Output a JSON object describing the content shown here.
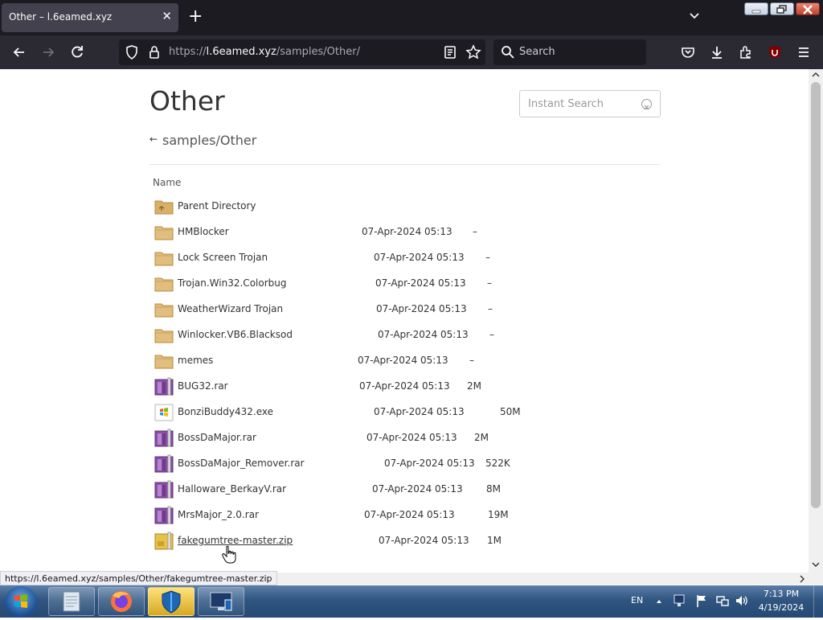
{
  "browser": {
    "tab": {
      "title": "Other – l.6eamed.xyz"
    },
    "url": {
      "prefix": "https://",
      "host": "l.6eamed.xyz",
      "path": "/samples/Other/"
    },
    "search": {
      "placeholder": "Search"
    },
    "ublock_badge": "1"
  },
  "page": {
    "heading": "Other",
    "instant_search": {
      "placeholder": "Instant Search"
    },
    "breadcrumb": {
      "back": "←",
      "path": "samples/Other"
    },
    "columns": {
      "name": "Name"
    },
    "rows": [
      {
        "name": "Parent Directory",
        "date": "",
        "size": "",
        "icon": "parent-folder-icon"
      },
      {
        "name": "HMBlocker",
        "date": "07-Apr-2024 05:13",
        "size": "–",
        "icon": "folder-icon"
      },
      {
        "name": "Lock Screen Trojan",
        "date": "07-Apr-2024 05:13",
        "size": "–",
        "icon": "folder-icon"
      },
      {
        "name": "Trojan.Win32.Colorbug",
        "date": "07-Apr-2024 05:13",
        "size": "–",
        "icon": "folder-icon"
      },
      {
        "name": "WeatherWizard Trojan",
        "date": "07-Apr-2024 05:13",
        "size": "–",
        "icon": "folder-icon"
      },
      {
        "name": "Winlocker.VB6.Blacksod",
        "date": "07-Apr-2024 05:13",
        "size": "–",
        "icon": "folder-icon"
      },
      {
        "name": "memes",
        "date": "07-Apr-2024 05:13",
        "size": "–",
        "icon": "folder-icon"
      },
      {
        "name": "BUG32.rar",
        "date": "07-Apr-2024 05:13",
        "size": "2M",
        "icon": "rar-archive-icon"
      },
      {
        "name": "BonziBuddy432.exe",
        "date": "07-Apr-2024 05:13",
        "size": "50M",
        "icon": "exe-icon"
      },
      {
        "name": "BossDaMajor.rar",
        "date": "07-Apr-2024 05:13",
        "size": "2M",
        "icon": "rar-archive-icon"
      },
      {
        "name": "BossDaMajor_Remover.rar",
        "date": "07-Apr-2024 05:13",
        "size": "522K",
        "icon": "rar-archive-icon"
      },
      {
        "name": "Halloware_BerkayV.rar",
        "date": "07-Apr-2024 05:13",
        "size": "8M",
        "icon": "rar-archive-icon"
      },
      {
        "name": "MrsMajor_2.0.rar",
        "date": "07-Apr-2024 05:13",
        "size": "19M",
        "icon": "rar-archive-icon"
      },
      {
        "name": "fakegumtree-master.zip",
        "date": "07-Apr-2024 05:13",
        "size": "1M",
        "icon": "zip-archive-icon"
      }
    ]
  },
  "status_bar": {
    "url": "https://l.6eamed.xyz/samples/Other/fakegumtree-master.zip"
  },
  "taskbar": {
    "language": "EN",
    "time": "7:13 PM",
    "date": "4/19/2024"
  }
}
